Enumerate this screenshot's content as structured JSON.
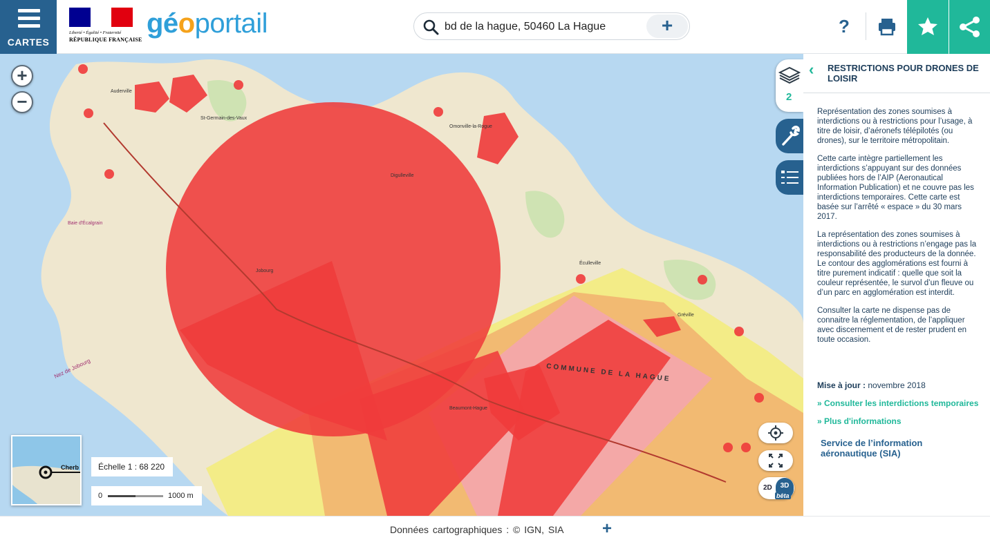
{
  "header": {
    "menu_label": "CARTES",
    "motto": "Liberté • Égalité • Fraternité",
    "republic": "RÉPUBLIQUE FRANÇAISE",
    "brand": {
      "geo": "gé",
      "o": "o",
      "portail": "portail"
    },
    "search_value": "bd de la hague, 50460 La Hague",
    "help_label": "?",
    "colors": {
      "primary": "#27618f",
      "accent": "#20b89a",
      "brand_blue": "#2f9fd9",
      "brand_orange": "#f5a21b"
    }
  },
  "map": {
    "scale_text": "Échelle 1 : 68 220",
    "scale_bar_start": "0",
    "scale_bar_distance": "1000 m",
    "overview_label": "Cherb",
    "layer_count": "2",
    "dim_2d": "2D",
    "dim_3d": "3D",
    "dim_beta": "bêta",
    "labels": {
      "commune": "COMMUNE DE LA HAGUE",
      "jobourg": "Jobourg",
      "beaumont": "Beaumont-Hague",
      "digulleville": "Digulleville",
      "omonville": "Omonville-la-Rogue",
      "auderville": "Auderville",
      "st_germain": "St-Germain-des-Vaux",
      "greville": "Gréville",
      "nez_jobourg": "Nez de Jobourg",
      "baie": "Baie d'Écalgrain",
      "eculleville": "Éculleville"
    },
    "zone_colors": {
      "red": "#ef3b3b",
      "pink": "#f4a6ad",
      "yellow": "#f3ec7a",
      "orange": "#f1b16e"
    }
  },
  "panel": {
    "title": "RESTRICTIONS POUR DRONES DE LOISIR",
    "paragraphs": [
      "Représentation des zones soumises à interdictions ou à restrictions pour l’usage, à titre de loisir, d’aéronefs télépilotés (ou drones), sur le territoire métropolitain.",
      "Cette carte intègre partiellement les interdictions s’appuyant sur des données publiées hors de l’AIP (Aeronautical Information Publication) et ne couvre pas les interdictions temporaires. Cette carte est basée sur l’arrêté « espace » du 30 mars 2017.",
      "La représentation des zones soumises à interdictions ou à restrictions n’engage pas la responsabilité des producteurs de la donnée. Le contour des agglomérations est fourni à titre purement indicatif : quelle que soit la couleur représentée, le survol d’un fleuve ou d’un parc en agglomération est interdit.",
      "Consulter la carte ne dispense pas de connaitre la réglementation, de l’appliquer avec discernement et de rester prudent en toute occasion."
    ],
    "update_label": "Mise à jour :",
    "update_value": "novembre 2018",
    "link_temp": "» Consulter les interdictions temporaires",
    "link_info": "» Plus d'informations",
    "service": "Service de l’information aéronautique (SIA)"
  },
  "footer": {
    "credits": "Données cartographiques : © IGN, SIA",
    "plus": "+"
  }
}
